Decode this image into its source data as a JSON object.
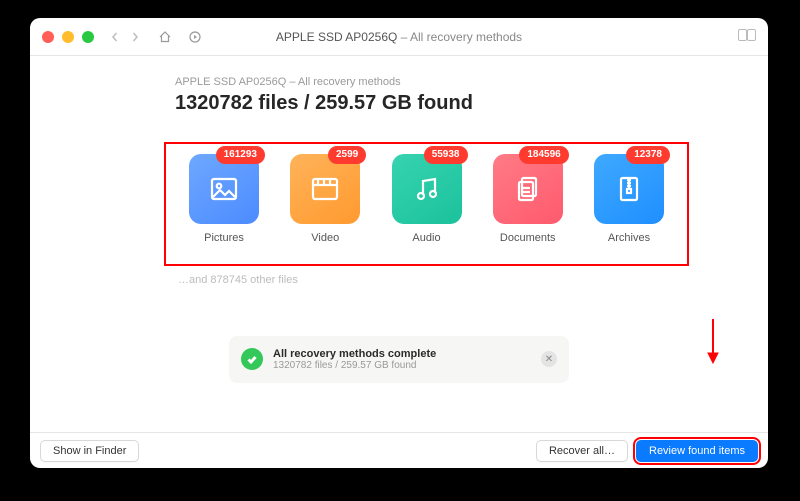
{
  "window": {
    "title_main": "APPLE SSD AP0256Q",
    "title_sep": " – ",
    "title_sub": "All recovery methods"
  },
  "breadcrumb": "APPLE SSD AP0256Q – All recovery methods",
  "headline": "1320782 files / 259.57 GB found",
  "categories": [
    {
      "key": "pictures",
      "label": "Pictures",
      "count": "161293"
    },
    {
      "key": "video",
      "label": "Video",
      "count": "2599"
    },
    {
      "key": "audio",
      "label": "Audio",
      "count": "55938"
    },
    {
      "key": "documents",
      "label": "Documents",
      "count": "184596"
    },
    {
      "key": "archives",
      "label": "Archives",
      "count": "12378"
    }
  ],
  "other_files": "…and 878745 other files",
  "status": {
    "title": "All recovery methods complete",
    "subtitle": "1320782 files / 259.57 GB found"
  },
  "buttons": {
    "show_in_finder": "Show in Finder",
    "recover_all": "Recover all…",
    "review": "Review found items"
  }
}
